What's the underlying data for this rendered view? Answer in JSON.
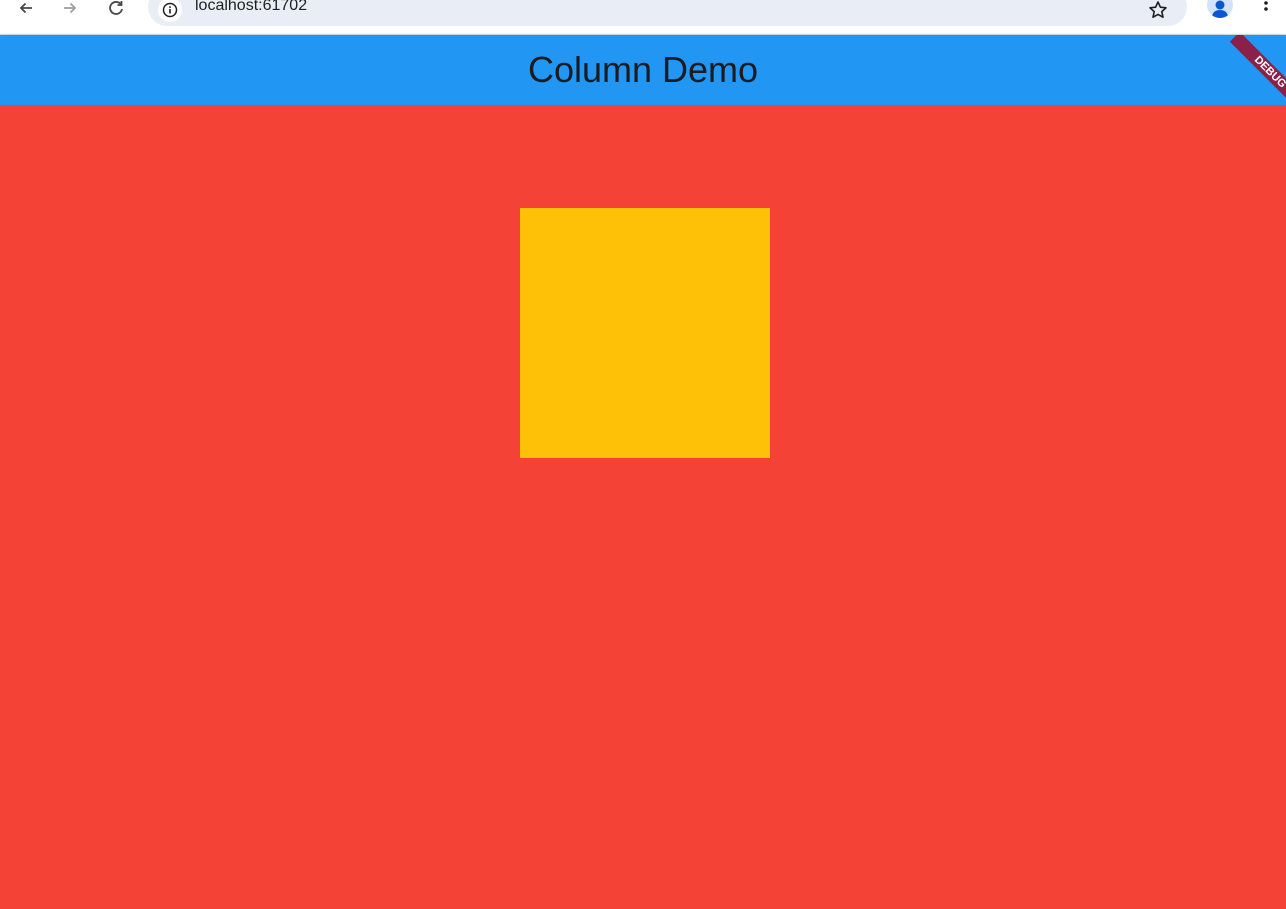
{
  "browser": {
    "url": "localhost:61702",
    "back_icon": "arrow-left-icon",
    "forward_icon": "arrow-right-icon",
    "reload_icon": "reload-icon",
    "site_info_icon": "info-icon",
    "bookmark_icon": "star-icon",
    "profile_icon": "person-icon",
    "menu_icon": "kebab-menu-icon"
  },
  "app": {
    "title": "Column Demo",
    "debug_label": "DEBUG",
    "colors": {
      "app_bar": "#2196f3",
      "body_background": "#f44336",
      "box": "#ffc107",
      "debug_banner": "#8b2048"
    }
  }
}
